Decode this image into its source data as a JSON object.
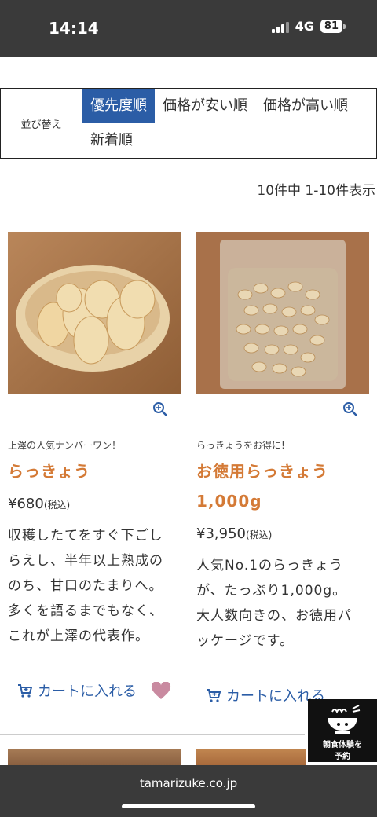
{
  "status": {
    "time": "14:14",
    "network": "4G",
    "battery": "81"
  },
  "sort": {
    "label": "並び替え",
    "options": [
      "優先度順",
      "価格が安い順",
      "価格が高い順",
      "新着順"
    ],
    "active_index": 0
  },
  "results": {
    "count_text": "10件中 1-10件表示"
  },
  "products": [
    {
      "catch": "上澤の人気ナンバーワン！",
      "name": "らっきょう",
      "price": "¥680",
      "tax": "(税込)",
      "desc": [
        "収穫したてをすぐ下ごし",
        "らえし、半年以上熟成の",
        "のち、甘口のたまりへ。",
        "多くを語るまでもなく、",
        "これが上澤の代表作。"
      ],
      "cart": "カートに入れる",
      "favorited": true
    },
    {
      "catch": "らっきょうをお得に!",
      "name_lines": [
        "お徳用らっきょう",
        "1,000g"
      ],
      "price": "¥3,950",
      "tax": "(税込)",
      "desc": [
        "人気No.1のらっきょう",
        "が、たっぷり1,000g。",
        "大人数向きの、お徳用パ",
        "ッケージです。"
      ],
      "cart": "カートに入れる",
      "favorited": false
    }
  ],
  "badge": {
    "line1": "朝食体験を",
    "line2": "予約"
  },
  "browser": {
    "url": "tamarizuke.co.jp"
  },
  "colors": {
    "accent": "#2b5da6",
    "product_name": "#d47a36",
    "favorite": "#c98aa0"
  }
}
